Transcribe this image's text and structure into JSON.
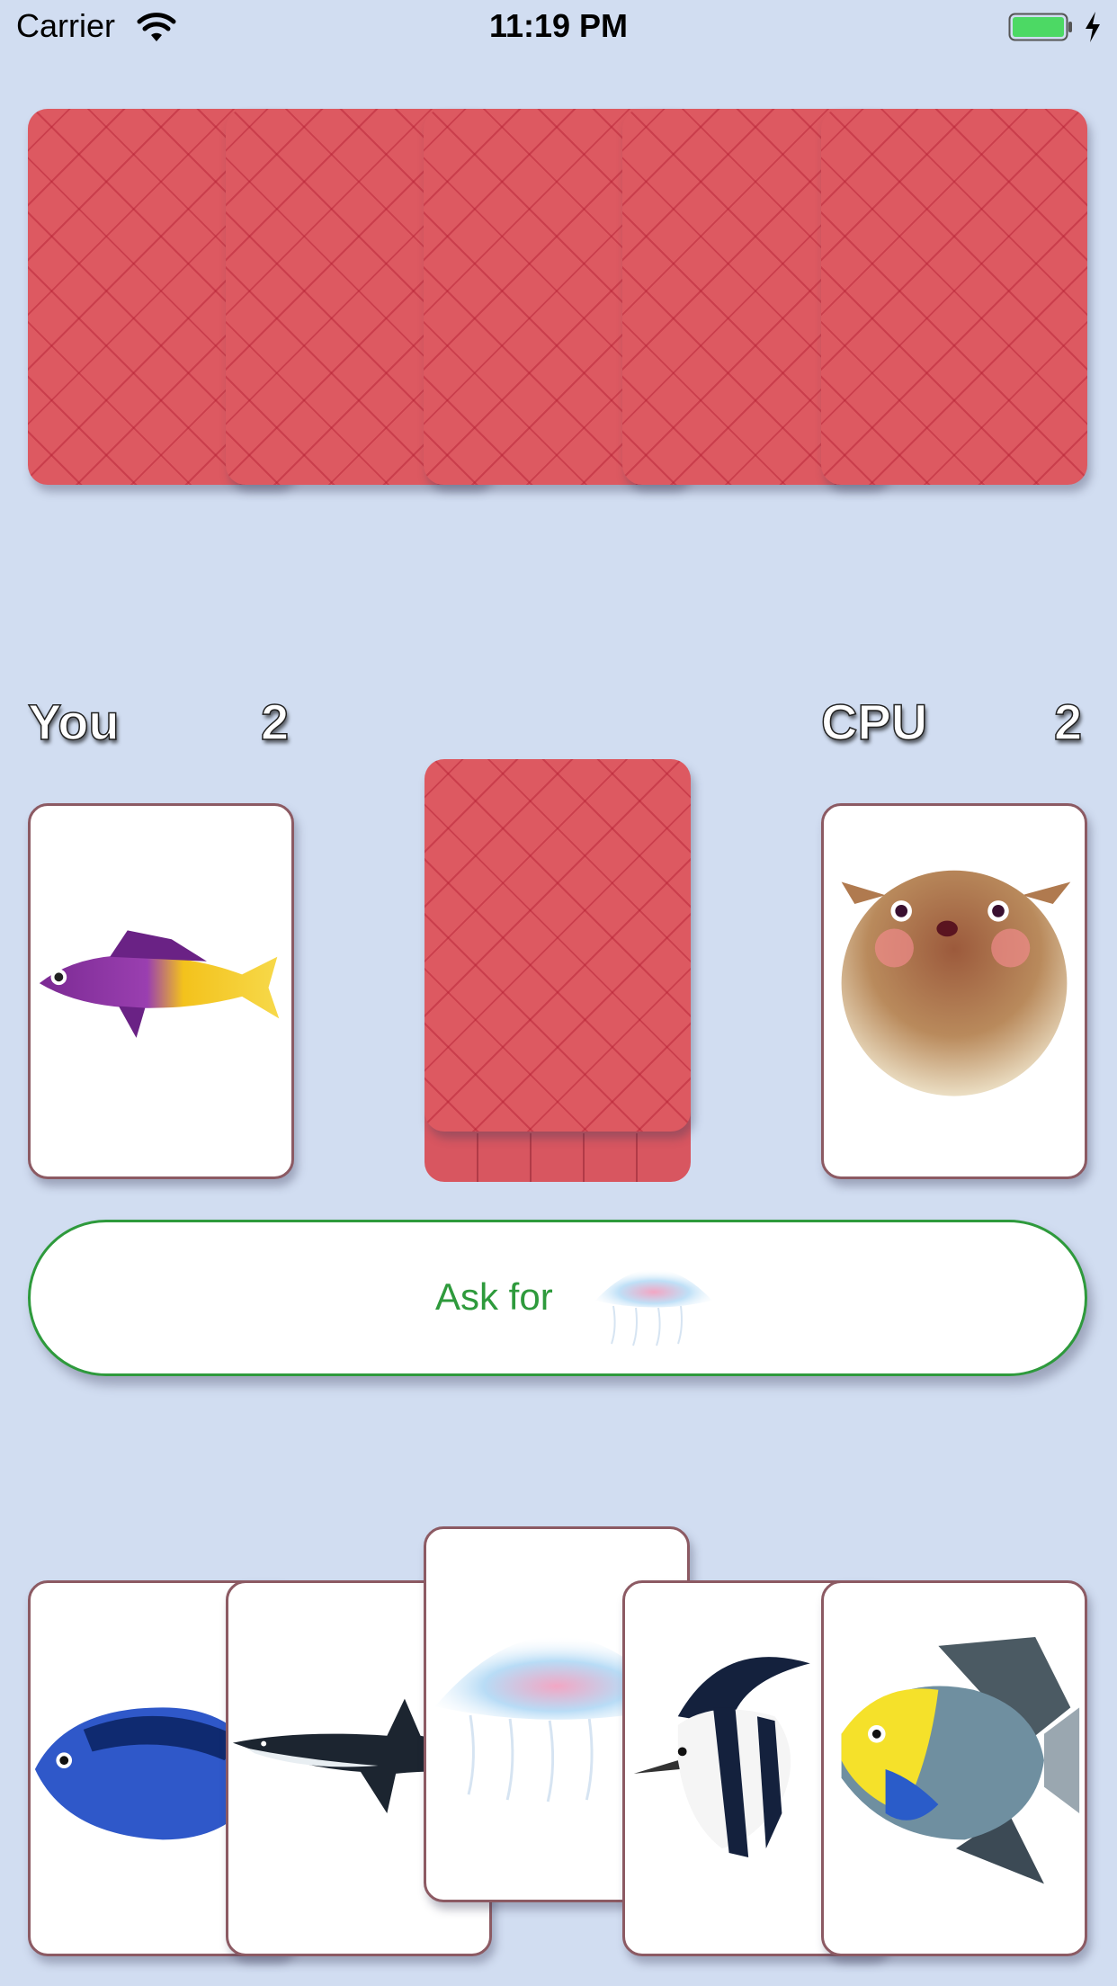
{
  "status_bar": {
    "carrier": "Carrier",
    "time": "11:19 PM",
    "battery_color": "#4cd964"
  },
  "opponent_hand": {
    "card_count": 5,
    "card_back_color": "#dd5961"
  },
  "scoreboard": {
    "player_label": "You",
    "player_score": "2",
    "cpu_label": "CPU",
    "cpu_score": "2"
  },
  "table": {
    "player_last_card": "purple-yellow-fish-icon",
    "cpu_last_card": "pufferfish-icon",
    "draw_pile": "card-back"
  },
  "ask_button": {
    "label": "Ask for",
    "icon": "jellyfish-icon",
    "accent_color": "#2e9a3c"
  },
  "player_hand": {
    "cards": [
      "blue-tang-icon",
      "shark-icon",
      "jellyfish-icon",
      "moorish-idol-icon",
      "angelfish-icon"
    ],
    "selected_index": 2
  }
}
